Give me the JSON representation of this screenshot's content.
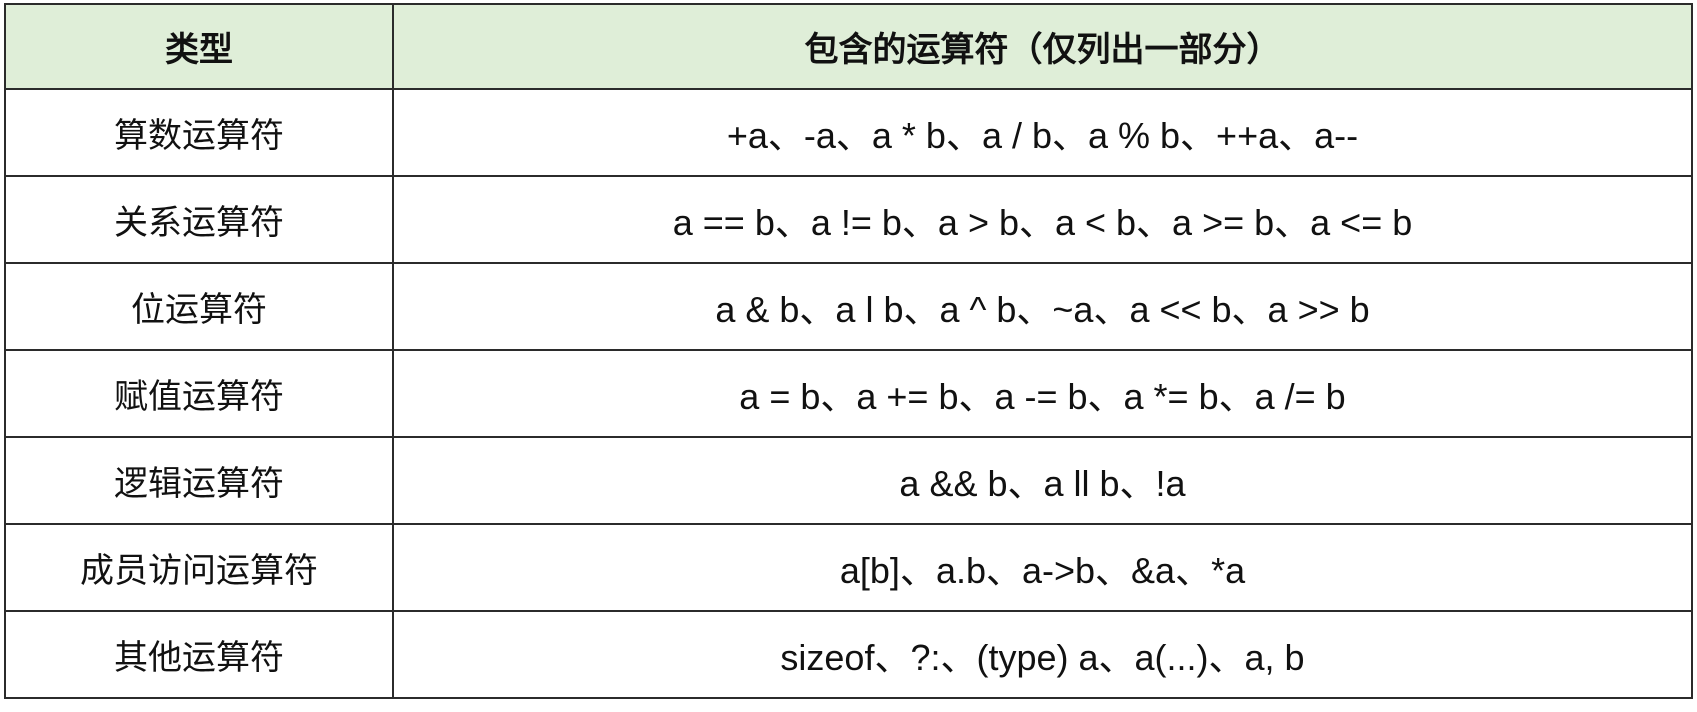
{
  "header": {
    "type": "类型",
    "operators": "包含的运算符（仅列出一部分）"
  },
  "header_bg": "#dfeed8",
  "border_color": "#2b2b2b",
  "rows": [
    {
      "type": "算数运算符",
      "operators": "+a、-a、a * b、a / b、a % b、++a、a--"
    },
    {
      "type": "关系运算符",
      "operators": "a == b、a != b、a > b、a < b、a >= b、a <= b"
    },
    {
      "type": "位运算符",
      "operators": "a & b、a l b、a ^ b、~a、a << b、a >> b"
    },
    {
      "type": "赋值运算符",
      "operators": "a = b、a += b、a -= b、a *= b、a /= b"
    },
    {
      "type": "逻辑运算符",
      "operators": "a && b、a ll b、!a"
    },
    {
      "type": "成员访问运算符",
      "operators": "a[b]、a.b、a->b、&a、*a"
    },
    {
      "type": "其他运算符",
      "operators": "sizeof、?:、(type) a、a(...)、a, b"
    }
  ]
}
